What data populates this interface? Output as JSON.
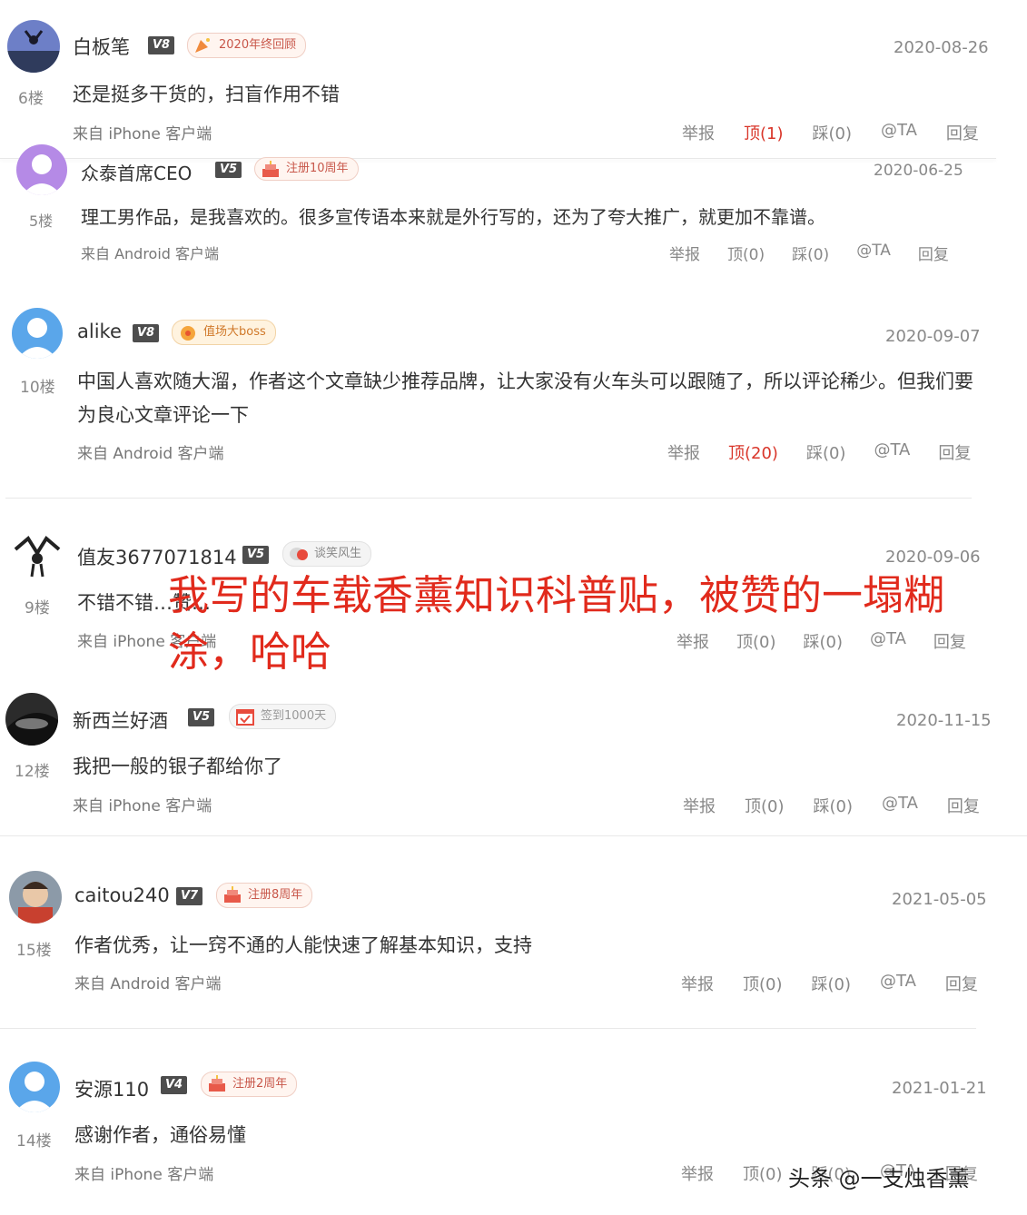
{
  "overlay_title": "我写的车载香薰知识科普贴，被赞的一塌糊涂，哈哈",
  "watermark": "头条 @一支烛香薰",
  "colors": {
    "accent_red": "#e12a1c",
    "level_bg": "#4d4d4d",
    "liked_red": "#d9362a"
  },
  "comments": [
    {
      "username": "白板笔",
      "level": "V8",
      "medal": "2020年终回顾",
      "date": "2020-08-26",
      "floor": "6楼",
      "text": "还是挺多干货的，扫盲作用不错",
      "source": "来自 iPhone 客户端",
      "actions": {
        "report": "举报",
        "up": "顶(1)",
        "down": "踩(0)",
        "at": "@TA",
        "reply": "回复"
      }
    },
    {
      "username": "众泰首席CEO",
      "level": "V5",
      "medal": "注册10周年",
      "date": "2020-06-25",
      "floor": "5楼",
      "text": "理工男作品，是我喜欢的。很多宣传语本来就是外行写的，还为了夸大推广，就更加不靠谱。",
      "source": "来自 Android 客户端",
      "actions": {
        "report": "举报",
        "up": "顶(0)",
        "down": "踩(0)",
        "at": "@TA",
        "reply": "回复"
      }
    },
    {
      "username": "alike",
      "level": "V8",
      "medal": "值场大boss",
      "date": "2020-09-07",
      "floor": "10楼",
      "text": "中国人喜欢随大溜，作者这个文章缺少推荐品牌，让大家没有火车头可以跟随了，所以评论稀少。但我们要为良心文章评论一下",
      "source": "来自 Android 客户端",
      "actions": {
        "report": "举报",
        "up": "顶(20)",
        "down": "踩(0)",
        "at": "@TA",
        "reply": "回复"
      }
    },
    {
      "username": "值友3677071814",
      "level": "V5",
      "medal": "谈笑风生",
      "date": "2020-09-06",
      "floor": "9楼",
      "text": "不错不错…赞…",
      "source": "来自 iPhone 客户端",
      "actions": {
        "report": "举报",
        "up": "顶(0)",
        "down": "踩(0)",
        "at": "@TA",
        "reply": "回复"
      }
    },
    {
      "username": "新西兰好酒",
      "level": "V5",
      "medal": "签到1000天",
      "date": "2020-11-15",
      "floor": "12楼",
      "text": "我把一般的银子都给你了",
      "source": "来自 iPhone 客户端",
      "actions": {
        "report": "举报",
        "up": "顶(0)",
        "down": "踩(0)",
        "at": "@TA",
        "reply": "回复"
      }
    },
    {
      "username": "caitou240",
      "level": "V7",
      "medal": "注册8周年",
      "date": "2021-05-05",
      "floor": "15楼",
      "text": "作者优秀，让一窍不通的人能快速了解基本知识，支持",
      "source": "来自 Android 客户端",
      "actions": {
        "report": "举报",
        "up": "顶(0)",
        "down": "踩(0)",
        "at": "@TA",
        "reply": "回复"
      }
    },
    {
      "username": "安源110",
      "level": "V4",
      "medal": "注册2周年",
      "date": "2021-01-21",
      "floor": "14楼",
      "text": "感谢作者，通俗易懂",
      "source": "来自 iPhone 客户端",
      "actions": {
        "report": "举报",
        "up": "顶(0)",
        "down": "踩(0)",
        "at": "@TA",
        "reply": "回复"
      }
    }
  ]
}
